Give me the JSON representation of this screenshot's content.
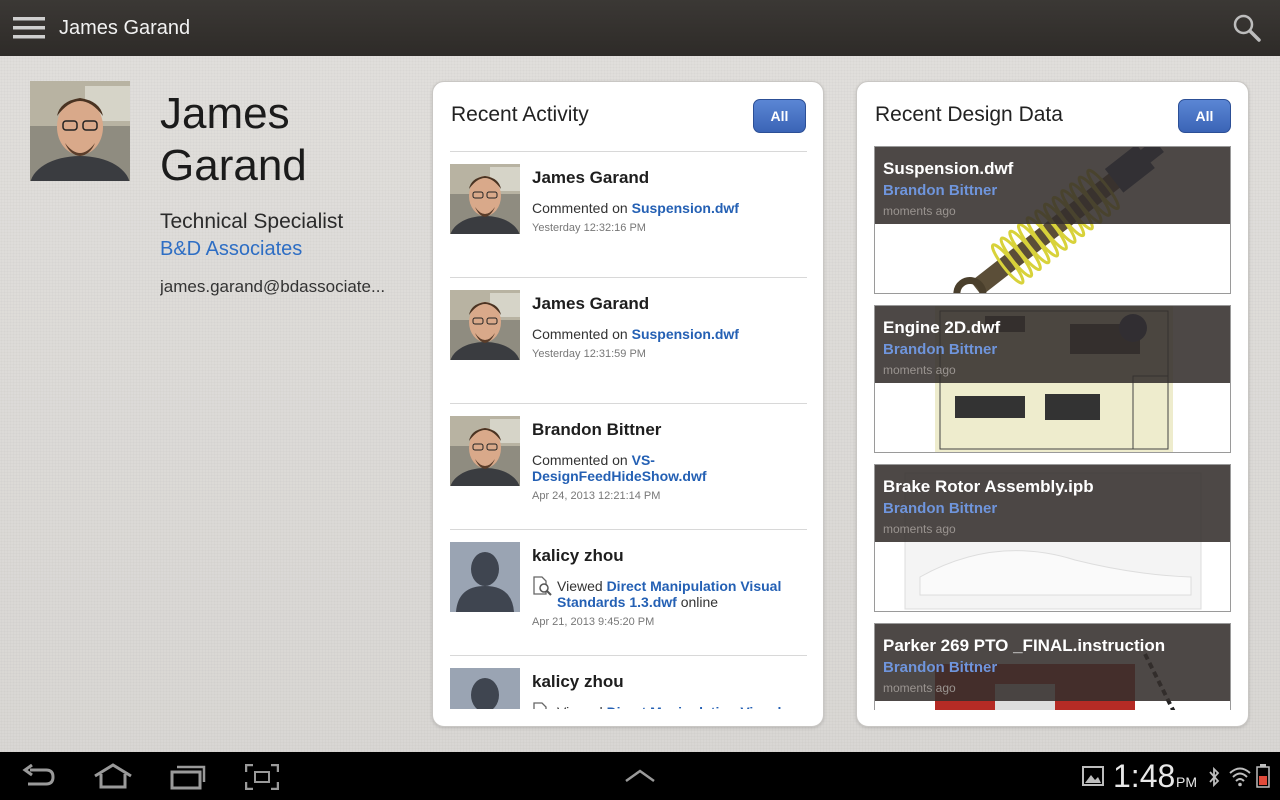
{
  "app": {
    "title": "James Garand"
  },
  "profile": {
    "first_name": "James",
    "last_name": "Garand",
    "role": "Technical Specialist",
    "company": "B&D Associates",
    "email": "james.garand@bdassociate..."
  },
  "activity": {
    "title": "Recent Activity",
    "all_label": "All",
    "items": [
      {
        "name": "James Garand",
        "action": "Commented on",
        "file": "Suspension.dwf",
        "suffix": "",
        "time": "Yesterday 12:32:16 PM",
        "avatar": "photo"
      },
      {
        "name": "James Garand",
        "action": "Commented on",
        "file": "Suspension.dwf",
        "suffix": "",
        "time": "Yesterday 12:31:59 PM",
        "avatar": "photo"
      },
      {
        "name": "Brandon Bittner",
        "action": "Commented on",
        "file": "VS-DesignFeedHideShow.dwf",
        "suffix": "",
        "time": "Apr 24, 2013 12:21:14 PM",
        "avatar": "photo"
      },
      {
        "name": "kalicy zhou",
        "action": "Viewed",
        "file": "Direct Manipulation Visual Standards 1.3.dwf",
        "suffix": "online",
        "time": "Apr 21, 2013 9:45:20 PM",
        "avatar": "silhouette"
      },
      {
        "name": "kalicy zhou",
        "action": "Viewed",
        "file": "Direct Manipulation Visual",
        "suffix": "",
        "time": "",
        "avatar": "silhouette"
      }
    ]
  },
  "design": {
    "title": "Recent Design Data",
    "all_label": "All",
    "items": [
      {
        "title": "Suspension.dwf",
        "author": "Brandon Bittner",
        "time": "moments ago",
        "preview": "suspension"
      },
      {
        "title": "Engine 2D.dwf",
        "author": "Brandon Bittner",
        "time": "moments ago",
        "preview": "engine"
      },
      {
        "title": "Brake Rotor Assembly.ipb",
        "author": "Brandon Bittner",
        "time": "moments ago",
        "preview": "brake"
      },
      {
        "title": "Parker 269 PTO _FINAL.instruction",
        "author": "Brandon Bittner",
        "time": "moments ago",
        "preview": "parker"
      }
    ]
  },
  "status_bar": {
    "time": "1:48",
    "ampm": "PM"
  },
  "colors": {
    "accent": "#3b64b6",
    "link": "#2460b4",
    "author": "#6f95dc",
    "topbar": "#2e2b28"
  },
  "icons": [
    "menu-icon",
    "search-icon",
    "back-icon",
    "home-icon",
    "recent-apps-icon",
    "screenshot-icon",
    "up-chevron-icon",
    "gallery-icon",
    "bluetooth-icon",
    "wifi-icon",
    "battery-icon",
    "view-icon"
  ]
}
